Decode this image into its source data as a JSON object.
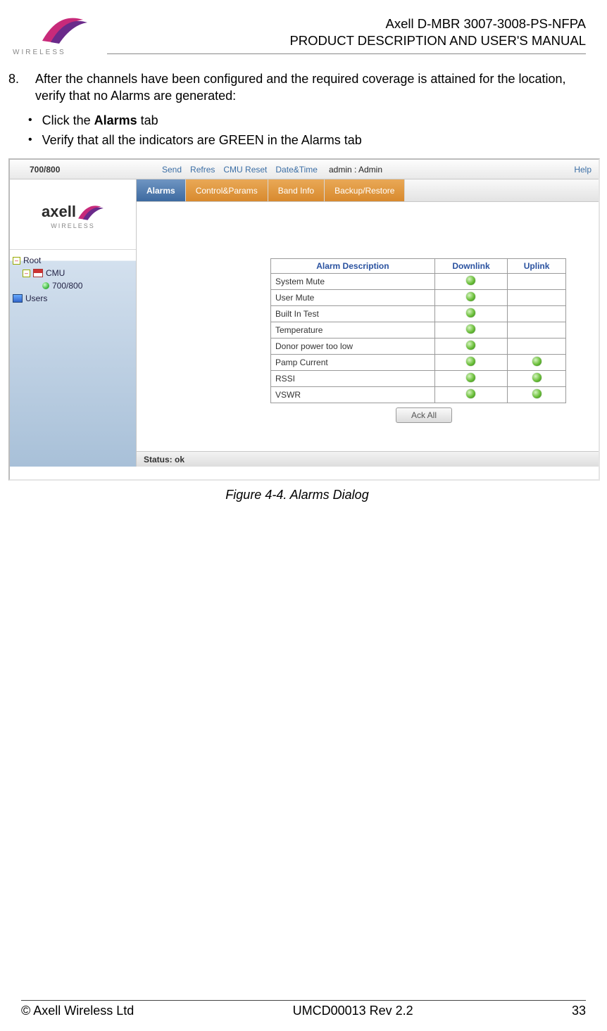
{
  "header": {
    "brand_word": "WIRELESS",
    "line1": "Axell D-MBR 3007-3008-PS-NFPA",
    "line2": "PRODUCT DESCRIPTION AND USER'S MANUAL"
  },
  "step": {
    "num": "8.",
    "text_a": "After the channels have been configured and the required coverage is attained for the location, verify that no Alarms are generated:",
    "bullet1_a": "Click the ",
    "bullet1_bold": "Alarms",
    "bullet1_b": " tab",
    "bullet2": "Verify that all the indicators are GREEN in the Alarms tab"
  },
  "app": {
    "title": "700/800",
    "links": {
      "send": "Send",
      "refresh": "Refres",
      "cmu_reset": "CMU Reset",
      "datetime": "Date&Time",
      "help": "Help"
    },
    "admin_label": "admin : Admin",
    "tabs": [
      "Alarms",
      "Control&Params",
      "Band Info",
      "Backup/Restore"
    ],
    "active_tab": 0,
    "logo_brand": "axell",
    "logo_sub": "WIRELESS",
    "tree": {
      "root": "Root",
      "cmu": "CMU",
      "leaf": "700/800",
      "users": "Users"
    },
    "alarm_headers": {
      "desc": "Alarm Description",
      "dl": "Downlink",
      "ul": "Uplink"
    },
    "alarm_rows": [
      {
        "name": "System Mute",
        "dl": true,
        "ul": false
      },
      {
        "name": "User Mute",
        "dl": true,
        "ul": false
      },
      {
        "name": "Built In Test",
        "dl": true,
        "ul": false
      },
      {
        "name": "Temperature",
        "dl": true,
        "ul": false
      },
      {
        "name": "Donor power too low",
        "dl": true,
        "ul": false
      },
      {
        "name": "Pamp Current",
        "dl": true,
        "ul": true
      },
      {
        "name": "RSSI",
        "dl": true,
        "ul": true
      },
      {
        "name": "VSWR",
        "dl": true,
        "ul": true
      }
    ],
    "ack_button": "Ack All",
    "status": "Status: ok"
  },
  "caption": "Figure 4-4. Alarms Dialog",
  "footer": {
    "left": "© Axell Wireless Ltd",
    "center": "UMCD00013 Rev 2.2",
    "right": "33"
  }
}
